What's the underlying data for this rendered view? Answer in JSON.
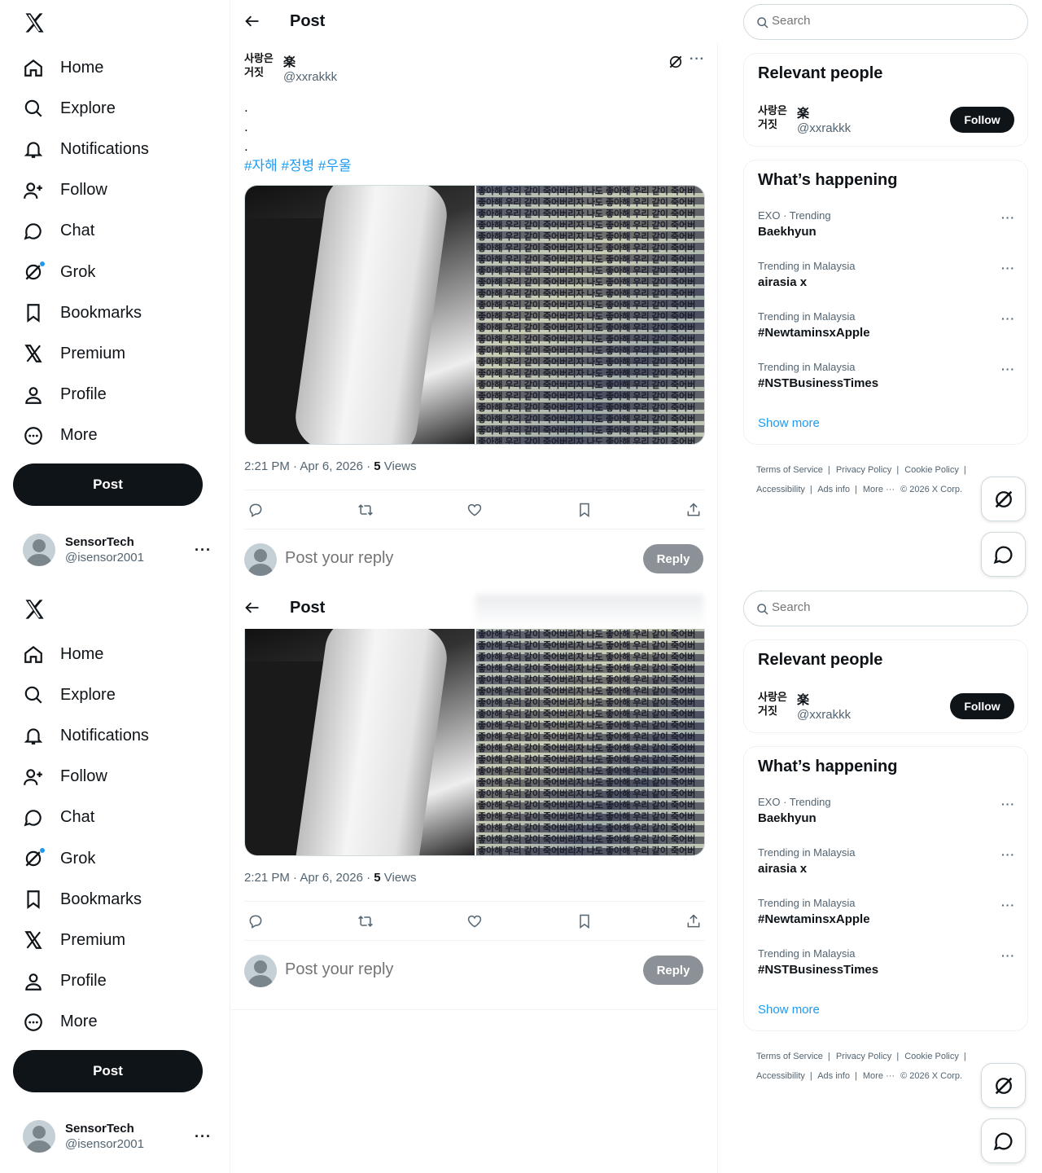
{
  "nav": {
    "items": [
      {
        "label": "Home",
        "icon": "home-icon"
      },
      {
        "label": "Explore",
        "icon": "search-icon"
      },
      {
        "label": "Notifications",
        "icon": "bell-icon"
      },
      {
        "label": "Follow",
        "icon": "add-user-icon"
      },
      {
        "label": "Chat",
        "icon": "chat-bubble-icon"
      },
      {
        "label": "Grok",
        "icon": "grok-icon"
      },
      {
        "label": "Bookmarks",
        "icon": "bookmark-icon"
      },
      {
        "label": "Premium",
        "icon": "x-logo-icon"
      },
      {
        "label": "Profile",
        "icon": "person-icon"
      },
      {
        "label": "More",
        "icon": "more-circle-icon"
      }
    ],
    "post_label": "Post"
  },
  "account": {
    "name": "SensorTech",
    "handle": "@isensor2001"
  },
  "header": {
    "title": "Post"
  },
  "tweet": {
    "author_avatar_text": "사랑은 거짓",
    "author_name": "楽",
    "author_handle": "@xxrakkk",
    "dots": [
      ".",
      ".",
      "."
    ],
    "hashtags": "#자해 #정병 #우울",
    "media_text": "좋아해 우리 같이 죽어버리자 나도 좋아해 우리 같이 죽어버",
    "time": "2:21 PM · Apr 6, 2026 · ",
    "views_count": "5",
    "views_label": " Views"
  },
  "reply": {
    "placeholder": "Post your reply",
    "button": "Reply"
  },
  "search": {
    "placeholder": "Search"
  },
  "relevant": {
    "title": "Relevant people",
    "follow": "Follow"
  },
  "trends": {
    "title": "What’s happening",
    "items": [
      {
        "context": "EXO · Trending",
        "name": "Baekhyun"
      },
      {
        "context": "Trending in Malaysia",
        "name": "airasia x"
      },
      {
        "context": "Trending in Malaysia",
        "name": "#NewtaminsxApple"
      },
      {
        "context": "Trending in Malaysia",
        "name": "#NSTBusinessTimes"
      }
    ],
    "show_more": "Show more"
  },
  "footer": {
    "terms": "Terms of Service",
    "privacy": "Privacy Policy",
    "cookie": "Cookie Policy",
    "accessibility": "Accessibility",
    "ads": "Ads info",
    "more": "More ···",
    "copyright": "© 2026 X Corp."
  },
  "colors": {
    "accent": "#1d9bf0",
    "text": "#0f1419",
    "muted": "#536471",
    "border": "#eff3f4"
  }
}
